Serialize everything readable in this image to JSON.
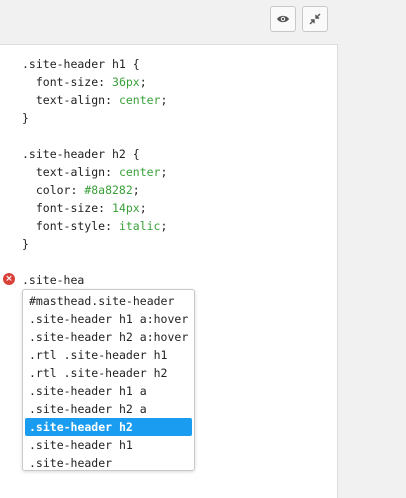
{
  "toolbar": {
    "preview_icon": "eye-icon",
    "collapse_icon": "collapse-arrows-icon"
  },
  "code_lines": [
    [
      {
        "t": ".site-header h1 {",
        "c": "p"
      }
    ],
    [
      {
        "t": "  font-size: ",
        "c": "p"
      },
      {
        "t": "36px",
        "c": "v"
      },
      {
        "t": ";",
        "c": "p"
      }
    ],
    [
      {
        "t": "  text-align: ",
        "c": "p"
      },
      {
        "t": "center",
        "c": "v"
      },
      {
        "t": ";",
        "c": "p"
      }
    ],
    [
      {
        "t": "}",
        "c": "p"
      }
    ],
    [
      {
        "t": "",
        "c": "p"
      }
    ],
    [
      {
        "t": ".site-header h2 {",
        "c": "p"
      }
    ],
    [
      {
        "t": "  text-align: ",
        "c": "p"
      },
      {
        "t": "center",
        "c": "v"
      },
      {
        "t": ";",
        "c": "p"
      }
    ],
    [
      {
        "t": "  color: ",
        "c": "p"
      },
      {
        "t": "#8a8282",
        "c": "v"
      },
      {
        "t": ";",
        "c": "p"
      }
    ],
    [
      {
        "t": "  font-size: ",
        "c": "p"
      },
      {
        "t": "14px",
        "c": "v"
      },
      {
        "t": ";",
        "c": "p"
      }
    ],
    [
      {
        "t": "  font-style: ",
        "c": "p"
      },
      {
        "t": "italic",
        "c": "v"
      },
      {
        "t": ";",
        "c": "p"
      }
    ],
    [
      {
        "t": "}",
        "c": "p"
      }
    ],
    [
      {
        "t": "",
        "c": "p"
      }
    ],
    [
      {
        "t": ".site-hea",
        "c": "p"
      }
    ]
  ],
  "error_marker": "×",
  "autocomplete": {
    "options": [
      "#masthead.site-header",
      ".site-header h1 a:hover",
      ".site-header h2 a:hover",
      ".rtl .site-header h1",
      ".rtl .site-header h2",
      ".site-header h1 a",
      ".site-header h2 a",
      ".site-header h2",
      ".site-header h1",
      ".site-header"
    ],
    "selected_index": 7
  },
  "colors": {
    "value": "#3aa13a",
    "selected_bg": "#1a9cf0",
    "error": "#d9403a"
  }
}
